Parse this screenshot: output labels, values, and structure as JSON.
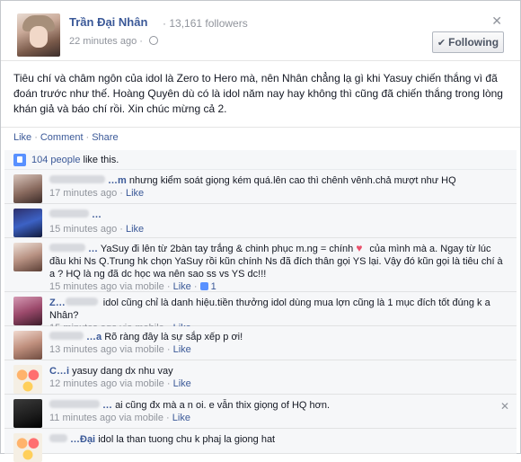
{
  "post": {
    "author": "Trần Đại Nhân",
    "followers": "13,161 followers",
    "time": "22 minutes ago",
    "follow_label": "Following",
    "body": "Tiêu chí và châm ngôn của idol là Zero to Hero mà, nên Nhân chẳng lạ gì khi Yasuy chiến thắng vì đã đoán trước như thế. Hoàng Quyên dù có là idol năm nay hay không thì cũng đã chiến thắng trong lòng khán giả và báo chí rồi. Xin chúc mừng cả 2."
  },
  "actions": {
    "like": "Like",
    "comment": "Comment",
    "share": "Share"
  },
  "likes": {
    "people": "104 people",
    "rest": "like this."
  },
  "comments": [
    {
      "name": "…m",
      "text": "nhưng kiểm soát giọng kém quá.lên cao thì chênh vênh.chả mượt như HQ",
      "time": "17 minutes ago",
      "mobile": "",
      "like": "Like",
      "likes": ""
    },
    {
      "name": "…",
      "text": "",
      "time": "15 minutes ago",
      "mobile": "",
      "like": "Like",
      "likes": ""
    },
    {
      "name": "…",
      "text": "YaSuy đi lên từ 2bàn tay trắng & chinh phục m.ng = chính",
      "text2": "của mình mà a. Ngay từ lúc đầu khi Ns Q.Trung hk chọn YaSuy rồi kũn chính Ns đã đích thân gọi YS lại. Vậy đó kũn gọi là tiêu chí à a ? HQ là ng đã dc học wa nên sao ss vs YS dc!!!",
      "time": "15 minutes ago",
      "mobile": "via mobile",
      "like": "Like",
      "likes": "1"
    },
    {
      "name": "Z…",
      "text": "idol cũng chỉ là danh hiệu.tiền thưởng idol dùng mua lợn cũng là 1 mục đích tốt đúng k a Nhân?",
      "time": "15 minutes ago",
      "mobile": "via mobile",
      "like": "Like",
      "likes": ""
    },
    {
      "name": "…a",
      "text": "Rõ ràng đây là sự sắp xếp p ơi!",
      "time": "13 minutes ago",
      "mobile": "via mobile",
      "like": "Like",
      "likes": ""
    },
    {
      "name": "C…i",
      "text": "yasuy dang dx nhu vay",
      "time": "12 minutes ago",
      "mobile": "via mobile",
      "like": "Like",
      "likes": ""
    },
    {
      "name": "…",
      "text": "ai cũng đx mà a n oi. e vẫn thix giọng of HQ hơn.",
      "time": "11 minutes ago",
      "mobile": "via mobile",
      "like": "Like",
      "likes": ""
    },
    {
      "name": "…Đại",
      "text": "idol la than tuong chu k phaj la giong hat",
      "time": "",
      "mobile": "",
      "like": "",
      "likes": ""
    }
  ]
}
